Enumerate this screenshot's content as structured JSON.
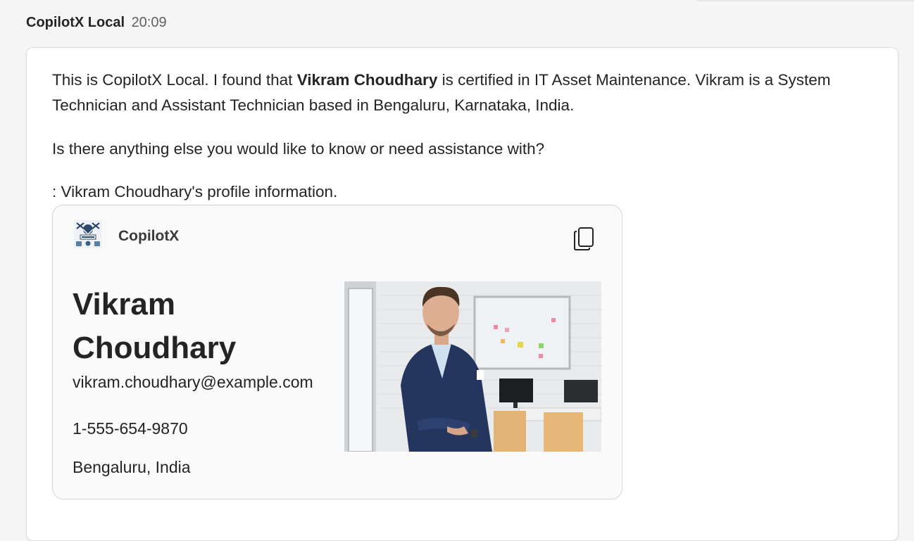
{
  "message": {
    "sender": "CopilotX Local",
    "time": "20:09",
    "para1_pre": "This is CopilotX Local. I found that ",
    "para1_bold": "Vikram Choudhary",
    "para1_post": " is certified in IT Asset Maintenance. Vikram is a System Technician and Assistant Technician based in Bengaluru, Karnataka, India.",
    "para2": "Is there anything else you would like to know or need assistance with?",
    "para3": ": Vikram Choudhary's profile information."
  },
  "card": {
    "brand": "CopilotX",
    "logo_icon": "copilotx-logo-icon",
    "copy_icon": "copy-icon",
    "name": "Vikram Choudhary",
    "email": "vikram.choudhary@example.com",
    "phone": "1-555-654-9870",
    "location": "Bengaluru, India",
    "photo": "profile-photo"
  },
  "colors": {
    "background": "#f5f5f5",
    "bubble": "#ffffff",
    "card": "#fafafa",
    "text": "#242424",
    "muted": "#616161"
  }
}
